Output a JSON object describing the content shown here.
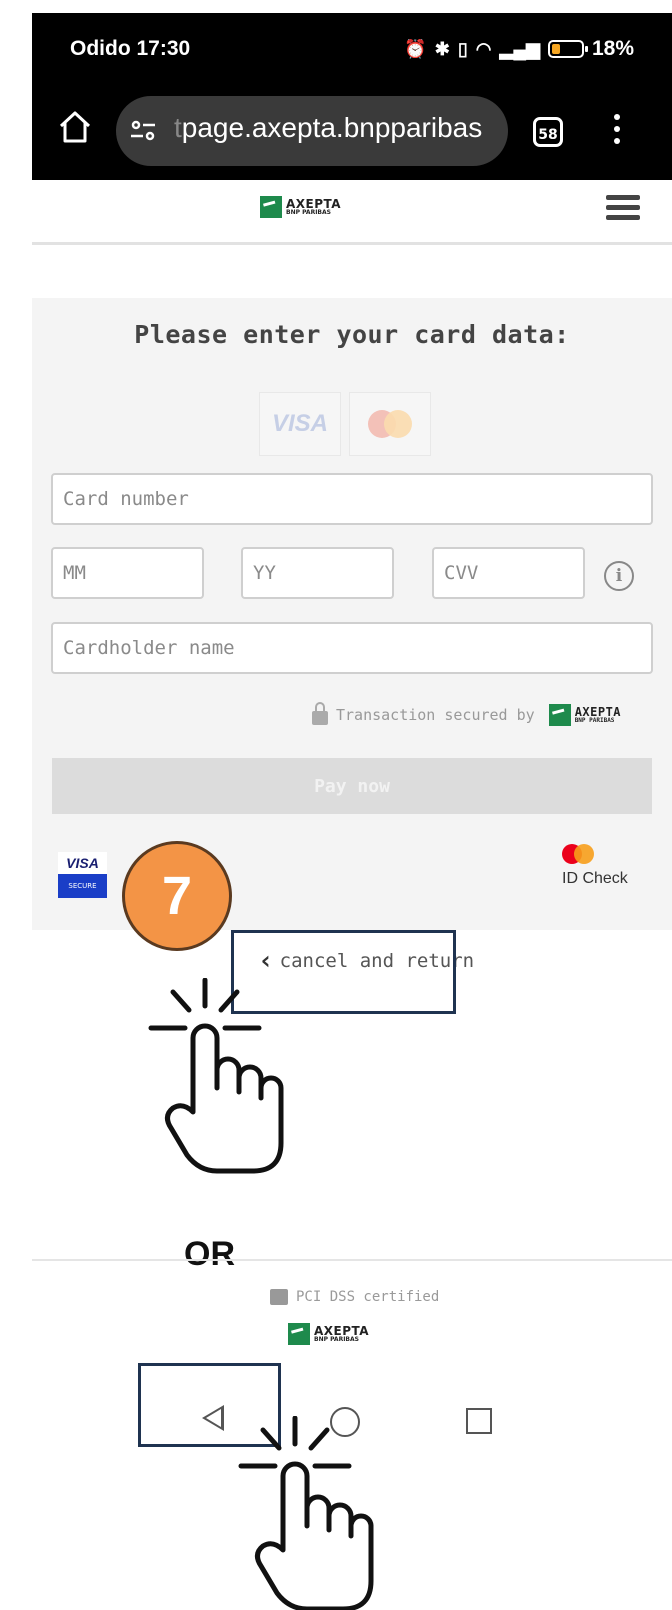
{
  "status_bar": {
    "carrier_time": "Odido 17:30",
    "icons": [
      "alarm-icon",
      "bluetooth-icon",
      "vibrate-icon",
      "wifi-icon",
      "signal-icon",
      "battery-icon"
    ],
    "battery": "18%"
  },
  "browser": {
    "url_prefix": "t",
    "url": "page.axepta.bnpparibas",
    "tab_count": "58"
  },
  "site": {
    "logo_name": "AXEPTA",
    "logo_sub": "BNP PARIBAS"
  },
  "form": {
    "title": "Please enter your card data:",
    "visa_label": "VISA",
    "card_number_placeholder": "Card number",
    "month_placeholder": "MM",
    "year_placeholder": "YY",
    "cvv_placeholder": "CVV",
    "cardholder_placeholder": "Cardholder name",
    "secured_text": "Transaction secured by",
    "pay_button": "Pay now",
    "visa_secure_top": "VISA",
    "visa_secure_bottom": "SECURE",
    "id_check": "ID Check",
    "cancel_link": "cancel and return"
  },
  "tutorial": {
    "step_number": "7",
    "or_label": "OR"
  },
  "footer": {
    "pci_text": "PCI DSS certified"
  },
  "colors": {
    "step_badge": "#f39446",
    "highlight_box": "#1f3350",
    "logo_green": "#1e8a4c",
    "visa_blue": "#1a3ec7"
  }
}
